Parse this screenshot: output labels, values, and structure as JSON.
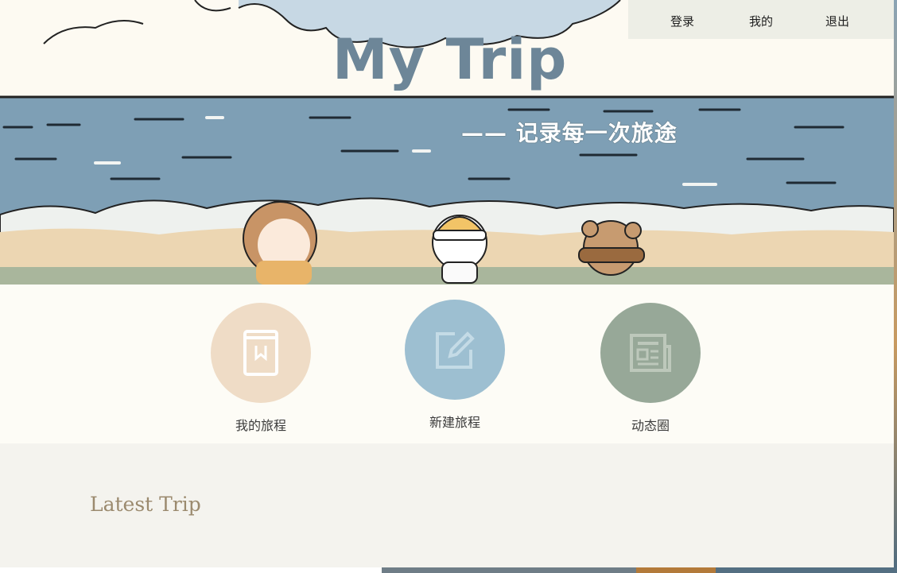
{
  "nav": {
    "login": "登录",
    "mine": "我的",
    "logout": "退出"
  },
  "banner": {
    "title": "My Trip",
    "tagline": "—— 记录每一次旅途"
  },
  "features": [
    {
      "label": "我的旅程",
      "icon": "book-icon",
      "color": "#efdcc6"
    },
    {
      "label": "新建旅程",
      "icon": "edit-icon",
      "color": "#9dbfd1"
    },
    {
      "label": "动态圈",
      "icon": "news-icon",
      "color": "#97a898"
    }
  ],
  "latest": {
    "title": "Latest Trip"
  },
  "colors": {
    "sea": "#7a9cb3",
    "sand": "#ecd6b2",
    "title": "#6d8698",
    "nav_bg": "#edeee6"
  }
}
